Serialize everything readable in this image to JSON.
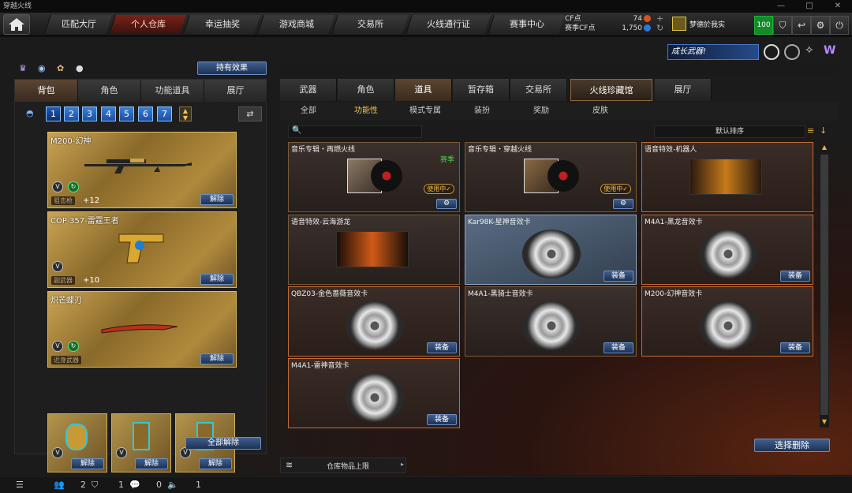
{
  "window": {
    "title": "穿越火线",
    "controls": [
      "—",
      "□",
      "✕"
    ]
  },
  "topnav": {
    "tabs": [
      "匹配大厅",
      "个人仓库",
      "幸运抽奖",
      "游戏商城",
      "交易所",
      "火线通行证",
      "赛事中心"
    ],
    "active_index": 1,
    "cf_label": "CF点",
    "cf_value": "74",
    "season_cf_label": "赛季CF点",
    "season_cf_value": "1,750",
    "username": "梦德於我实",
    "level": "100"
  },
  "banner": {
    "text": "成长武器!"
  },
  "left": {
    "effects_button": "持有效果",
    "tabs": [
      "背包",
      "角色",
      "功能道具",
      "展厅"
    ],
    "active_tab": 0,
    "pages": [
      "1",
      "2",
      "3",
      "4",
      "5",
      "6",
      "7"
    ],
    "active_page": 0,
    "weapons": [
      {
        "name": "M200-幻神",
        "category": "狙击枪",
        "count": "+12",
        "remove": "解除"
      },
      {
        "name": "COP 357-雷霆王者",
        "category": "副武器",
        "count": "+10",
        "remove": "解除"
      },
      {
        "name": "炽芒蝶刃",
        "category": "近身武器",
        "count": "",
        "remove": "解除"
      }
    ],
    "small_remove": [
      "解除",
      "解除",
      "解除"
    ],
    "remove_all": "全部解除"
  },
  "right": {
    "tabs": [
      "武器",
      "角色",
      "道具",
      "暂存箱",
      "交易所",
      "火线珍藏馆",
      "展厅"
    ],
    "active_tab": 2,
    "subtabs": [
      "全部",
      "功能性",
      "模式专属",
      "装扮",
      "奖励",
      "皮肤"
    ],
    "active_sub": 1,
    "sort": "默认排序",
    "items": [
      {
        "title": "音乐专辑・再燃火线",
        "kind": "album",
        "badge": "赛季",
        "in_use": "使用中✓"
      },
      {
        "title": "音乐专辑・穿越火线",
        "kind": "album",
        "badge": "",
        "in_use": "使用中✓"
      },
      {
        "title": "语音特效-机器人",
        "kind": "voice",
        "badge": "",
        "in_use": ""
      },
      {
        "title": "语音特效-云海游龙",
        "kind": "voice",
        "badge": "",
        "in_use": ""
      },
      {
        "title": "Kar98K-星神音效卡",
        "kind": "disc",
        "badge": "",
        "in_use": "",
        "equip": "装备"
      },
      {
        "title": "M4A1-黑龙音效卡",
        "kind": "disc",
        "badge": "",
        "in_use": "",
        "equip": "装备"
      },
      {
        "title": "QBZ03-金色蔷薇音效卡",
        "kind": "disc",
        "badge": "",
        "in_use": "",
        "equip": "装备"
      },
      {
        "title": "M4A1-黑骑士音效卡",
        "kind": "disc",
        "badge": "",
        "in_use": "",
        "equip": "装备"
      },
      {
        "title": "M200-幻神音效卡",
        "kind": "disc",
        "badge": "",
        "in_use": "",
        "equip": "装备"
      },
      {
        "title": "M4A1-雷神音效卡",
        "kind": "disc",
        "badge": "",
        "in_use": "",
        "equip": "装备"
      }
    ],
    "select_delete": "选择删除",
    "storage_limit": "仓库物品上限"
  },
  "status": {
    "friends": "2",
    "shield": "1",
    "chat": "0",
    "volume": "1"
  }
}
